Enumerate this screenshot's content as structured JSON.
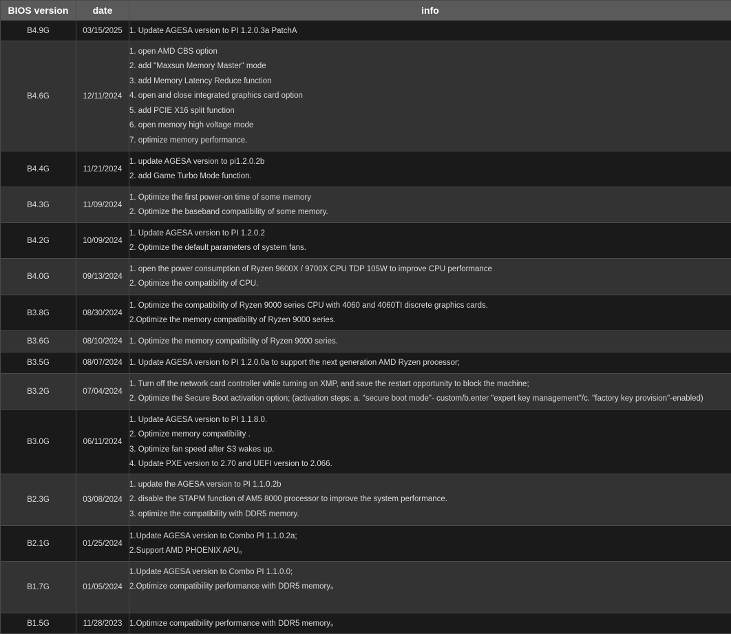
{
  "headers": {
    "version": "BIOS version",
    "date": "date",
    "info": "info"
  },
  "rows": [
    {
      "version": "B4.9G",
      "date": "03/15/2025",
      "info": [
        "1. Update AGESA version to PI 1.2.0.3a PatchA"
      ]
    },
    {
      "version": "B4.6G",
      "date": "12/11/2024",
      "info": [
        "1. open AMD CBS option",
        "2. add \"Maxsun Memory Master\" mode",
        "3. add Memory Latency Reduce function",
        "4. open and close integrated graphics card option",
        "5. add PCIE X16 split function",
        "6. open memory high voltage mode",
        "7. optimize memory performance."
      ]
    },
    {
      "version": "B4.4G",
      "date": "11/21/2024",
      "info": [
        "1. update AGESA version to pi1.2.0.2b",
        "2. add Game Turbo Mode function."
      ]
    },
    {
      "version": "B4.3G",
      "date": "11/09/2024",
      "info": [
        "1. Optimize the first power-on time of some memory",
        "2. Optimize the baseband compatibility of some memory."
      ]
    },
    {
      "version": "B4.2G",
      "date": "10/09/2024",
      "info": [
        "1. Update AGESA version to PI 1.2.0.2",
        "2. Optimize the default parameters of system fans."
      ]
    },
    {
      "version": "B4.0G",
      "date": "09/13/2024",
      "info": [
        "1. open the power consumption of Ryzen 9600X / 9700X CPU TDP 105W to improve CPU performance",
        "2. Optimize the compatibility of CPU."
      ]
    },
    {
      "version": "B3.8G",
      "date": "08/30/2024",
      "info": [
        "1. Optimize the compatibility of Ryzen 9000 series CPU with 4060 and 4060TI discrete graphics cards.",
        "2.Optimize the memory compatibility of Ryzen 9000 series."
      ]
    },
    {
      "version": "B3.6G",
      "date": "08/10/2024",
      "info": [
        "1. Optimize the memory compatibility of Ryzen 9000 series."
      ]
    },
    {
      "version": "B3.5G",
      "date": "08/07/2024",
      "info": [
        "1. Update AGESA version to PI 1.2.0.0a to support the next generation AMD Ryzen processor;"
      ]
    },
    {
      "version": "B3.2G",
      "date": "07/04/2024",
      "info": [
        "1. Turn off the network card controller while turning on XMP, and save the restart opportunity to block the machine;",
        "2. Optimize the Secure Boot activation option; (activation steps: a. \"secure boot mode\"- custom/b.enter \"expert key management\"/c. \"factory key provision\"-enabled)"
      ]
    },
    {
      "version": "B3.0G",
      "date": "06/11/2024",
      "info": [
        "1. Update AGESA version to PI 1.1.8.0.",
        "2. Optimize memory compatibility .",
        "3. Optimize fan speed after S3 wakes up.",
        "4. Update PXE version to 2.70 and UEFI version to 2.066."
      ]
    },
    {
      "version": "B2.3G",
      "date": "03/08/2024",
      "info": [
        "1. update the AGESA version to  PI  1.1.0.2b",
        "2. disable the STAPM function of AM5 8000 processor to improve the system performance.",
        "3. optimize the compatibility with DDR5 memory."
      ]
    },
    {
      "version": "B2.1G",
      "date": "01/25/2024",
      "info": [
        "1.Update AGESA version to Combo  PI 1.1.0.2a;",
        "2.Support AMD PHOENIX APU。"
      ]
    },
    {
      "version": "B1.7G",
      "date": "01/05/2024",
      "info": [
        "1.Update AGESA version to Combo  PI 1.1.0.0;",
        "2.Optimize compatibility performance with DDR5 memory。"
      ]
    },
    {
      "version": "B1.5G",
      "date": "11/28/2023",
      "info": [
        "1.Optimize compatibility performance with DDR5 memory。"
      ]
    }
  ]
}
